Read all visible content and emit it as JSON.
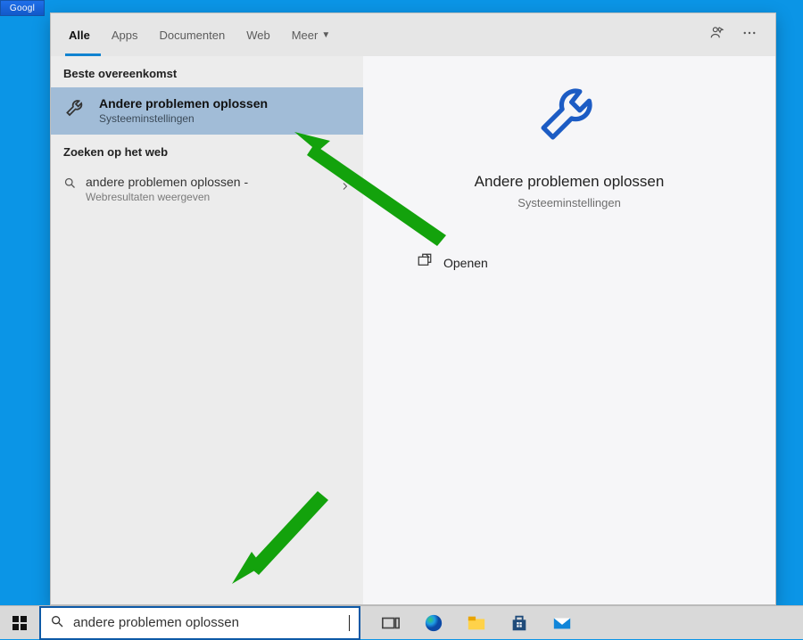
{
  "desktop_icon_label": "Googl",
  "tabs": {
    "all": "Alle",
    "apps": "Apps",
    "documents": "Documenten",
    "web": "Web",
    "more": "Meer"
  },
  "left": {
    "best_match_header": "Beste overeenkomst",
    "best_match": {
      "title": "Andere problemen oplossen",
      "subtitle": "Systeeminstellingen"
    },
    "web_header": "Zoeken op het web",
    "web_result": {
      "title": "andere problemen oplossen -",
      "subtitle": "Webresultaten weergeven"
    }
  },
  "preview": {
    "title": "Andere problemen oplossen",
    "subtitle": "Systeeminstellingen",
    "open_label": "Openen"
  },
  "search": {
    "value": "andere problemen oplossen"
  },
  "colors": {
    "accent": "#1183d0",
    "selected": "#a1bcd7",
    "arrow": "#13a20c",
    "search_border": "#0d59a6"
  }
}
